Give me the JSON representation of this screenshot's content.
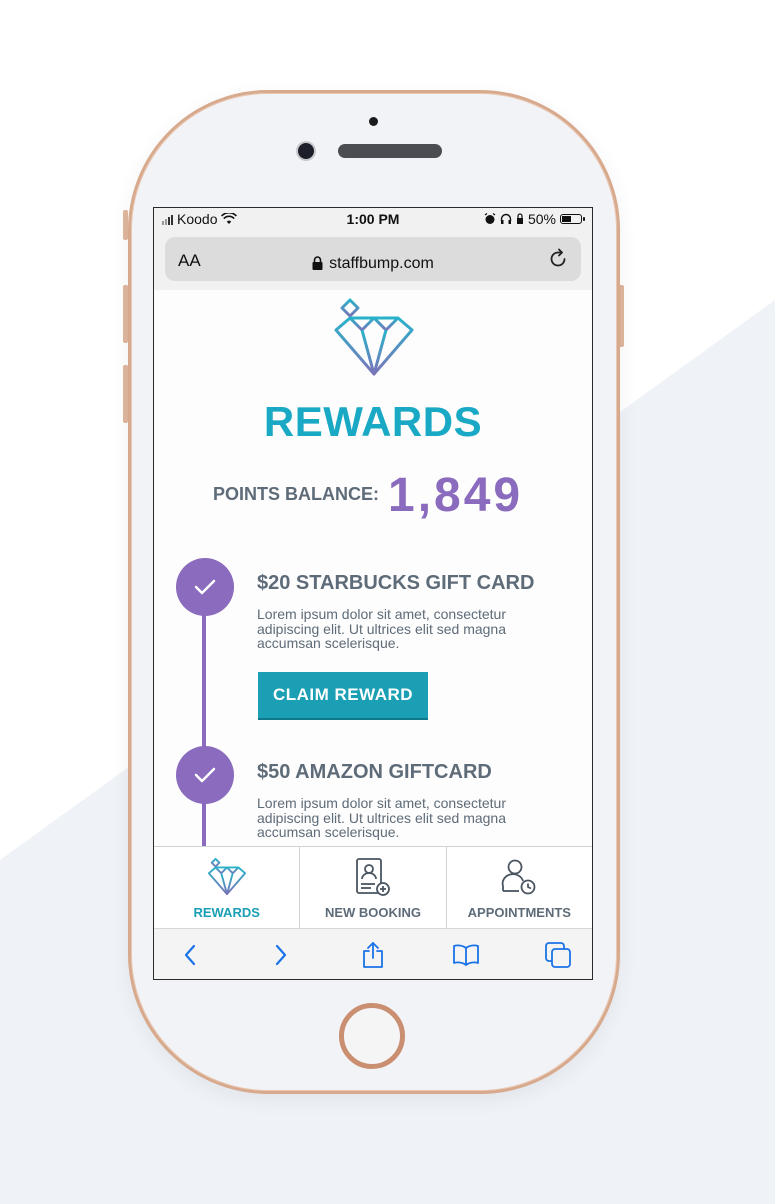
{
  "status_bar": {
    "carrier": "Koodo",
    "time": "1:00 PM",
    "battery": "50%"
  },
  "browser": {
    "text_size_label": "AA",
    "url": "staffbump.com"
  },
  "page": {
    "title": "REWARDS",
    "balance_label": "POINTS BALANCE:",
    "balance_value": "1,849",
    "rewards": [
      {
        "title": "$20 STARBUCKS GIFT CARD",
        "description_lines": [
          "Lorem ipsum dolor sit amet, consectetur",
          "adipiscing elit. Ut ultrices elit sed magna",
          "accumsan scelerisque."
        ],
        "button_label": "CLAIM REWARD"
      },
      {
        "title": "$50 AMAZON GIFTCARD",
        "description_lines": [
          "Lorem ipsum dolor sit amet, consectetur",
          "adipiscing elit. Ut ultrices elit sed magna",
          "accumsan scelerisque."
        ]
      }
    ]
  },
  "tabs": [
    {
      "label": "REWARDS",
      "icon": "diamond-icon",
      "active": true
    },
    {
      "label": "NEW BOOKING",
      "icon": "booking-icon",
      "active": false
    },
    {
      "label": "APPOINTMENTS",
      "icon": "appointments-icon",
      "active": false
    }
  ],
  "colors": {
    "accent": "#1aa9c4",
    "purple": "#8a6bbd",
    "text": "#5e6b78",
    "phone_frame": "#d7a98d"
  }
}
